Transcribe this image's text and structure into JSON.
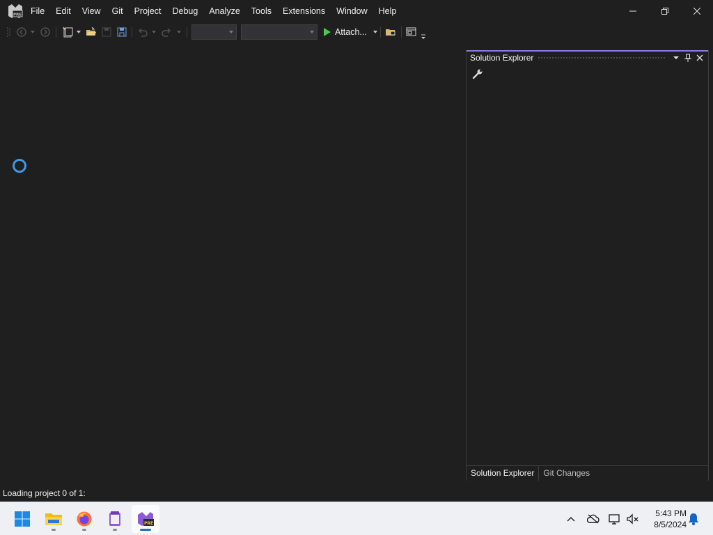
{
  "app": {
    "logo_badge": "PRE",
    "logo_icon": "visual-studio-preview-icon"
  },
  "menu": {
    "items": [
      "File",
      "Edit",
      "View",
      "Git",
      "Project",
      "Debug",
      "Analyze",
      "Tools",
      "Extensions",
      "Window",
      "Help"
    ]
  },
  "window_controls": {
    "minimize": "minimize-icon",
    "restore": "restore-icon",
    "close": "close-icon"
  },
  "toolbar": {
    "attach_label": "Attach...",
    "icons": [
      "navigate-back-icon",
      "navigate-forward-icon",
      "new-project-icon",
      "open-folder-icon",
      "save-icon",
      "save-all-icon",
      "undo-icon",
      "redo-icon",
      "play-icon",
      "folder-open-icon",
      "window-layout-icon"
    ],
    "configuration_value": "",
    "platform_value": ""
  },
  "solution_explorer": {
    "title": "Solution Explorer",
    "tabs": [
      "Solution Explorer",
      "Git Changes"
    ],
    "active_tab": "Solution Explorer"
  },
  "status": {
    "text": "Loading project 0 of 1:"
  },
  "taskbar": {
    "apps": [
      "windows-start-icon",
      "file-explorer-icon",
      "firefox-icon",
      "notepad-icon",
      "visual-studio-preview-icon"
    ],
    "tray": [
      "chevron-up-icon",
      "cloud-offline-icon",
      "network-icon",
      "volume-muted-icon",
      "notification-bell-icon"
    ],
    "time": "5:43 PM",
    "date": "8/5/2024"
  },
  "colors": {
    "background": "#1f1f1f",
    "accent": "#8c7ae6",
    "spinner": "#3c9ae8",
    "play": "#4ec94e",
    "taskbar": "#eef0f3"
  }
}
